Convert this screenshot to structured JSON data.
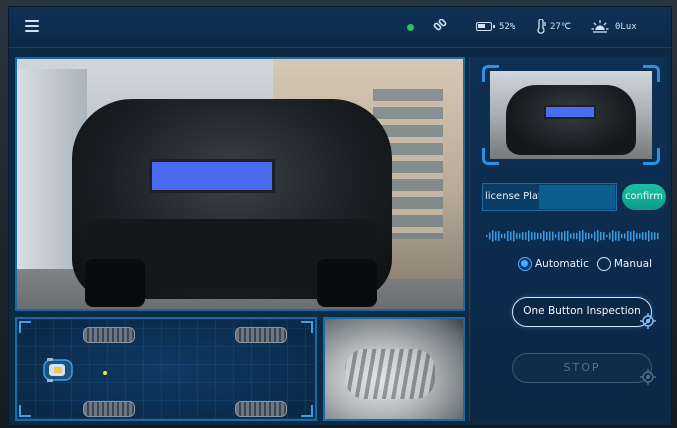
{
  "header": {
    "battery": "52%",
    "temperature": "27℃",
    "illuminance": "0Lux",
    "connection_status_color": "#22c55e"
  },
  "icons": {
    "menu": "hamburger-menu-icon",
    "link": "link-icon",
    "battery": "battery-icon",
    "temperature": "thermometer-icon",
    "light": "sun-icon",
    "target": "crosshair-icon"
  },
  "plate": {
    "label": "license Plate",
    "value": "",
    "confirm_label": "confirm"
  },
  "mode": {
    "options": [
      "Automatic",
      "Manual"
    ],
    "selected": "Automatic"
  },
  "actions": {
    "inspect_label": "One Button Inspection",
    "stop_label": "STOP"
  },
  "colors": {
    "accent": "#1a6aa6",
    "confirm": "#14b39b",
    "plate_mask": "#4a6cf0"
  }
}
